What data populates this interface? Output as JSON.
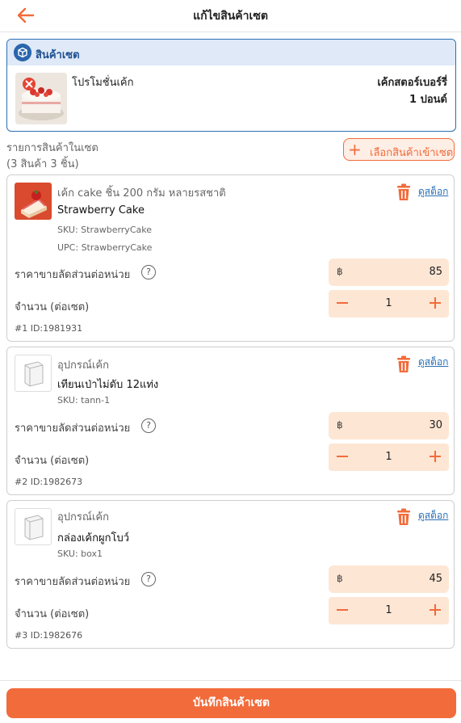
{
  "header": {
    "title": "แก้ไขสินค้าเซต"
  },
  "set": {
    "section_label": "สินค้าเซต",
    "name": "โปรโมชั่นเค้ก",
    "shop": "เค้กสตอร์เบอร์รี่",
    "size": "1 ปอนด์"
  },
  "list": {
    "title": "รายการสินค้าในเซต",
    "count": "(3 สินค้า 3 ชิ้น)",
    "choose_label": "เลือกสินค้าเข้าเซต"
  },
  "labels": {
    "price": "ราคาขายลัดส่วนต่อหน่วย",
    "qty": "จำนวน (ต่อเซต)",
    "currency": "฿",
    "stock": "ดูสต็อก",
    "help": "?"
  },
  "items": [
    {
      "category": "เค้ก cake ชิ้น 200 กรัม หลายรสชาติ",
      "name": "Strawberry Cake",
      "sku": "SKU: StrawberryCake",
      "upc": "UPC: StrawberryCake",
      "price": "85",
      "qty": "1",
      "id": "#1 ID:1981931"
    },
    {
      "category": "อุปกรณ์เค้ก",
      "name": "เทียนเป่าไม่ดับ 12แท่ง",
      "sku": "SKU: tann-1",
      "price": "30",
      "qty": "1",
      "id": "#2 ID:1982673"
    },
    {
      "category": "อุปกรณ์เค้ก",
      "name": "กล่องเค้กผูกโบว์",
      "sku": "SKU: box1",
      "price": "45",
      "qty": "1",
      "id": "#3 ID:1982676"
    }
  ],
  "footer": {
    "save_label": "บันทึกสินค้าเซต"
  },
  "colors": {
    "accent": "#f26b3a",
    "field_bg": "#fde6d4",
    "set_border": "#2a6fb5"
  }
}
